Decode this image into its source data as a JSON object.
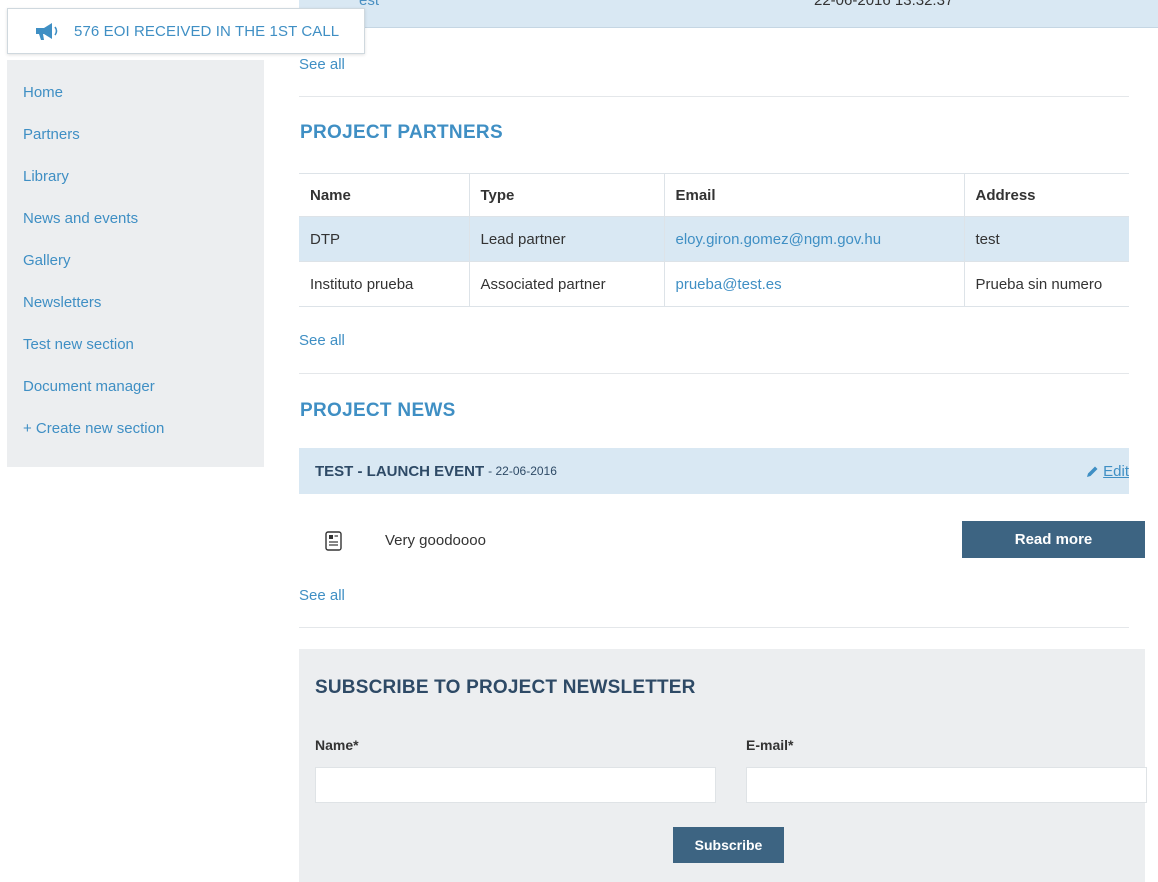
{
  "top_row": {
    "name_fragment": "est",
    "date_fragment": "22-06-2016 13:32:37"
  },
  "announcement": {
    "text": "576 EOI RECEIVED IN THE 1ST CALL",
    "icon": "megaphone-icon"
  },
  "sidebar": {
    "items": [
      {
        "label": "Home"
      },
      {
        "label": "Partners"
      },
      {
        "label": "Library"
      },
      {
        "label": "News and events"
      },
      {
        "label": "Gallery"
      },
      {
        "label": "Newsletters"
      },
      {
        "label": "Test new section"
      },
      {
        "label": "Document manager"
      },
      {
        "label": "+ Create new section"
      }
    ]
  },
  "see_all_label": "See all",
  "partners": {
    "title": "PROJECT PARTNERS",
    "columns": [
      "Name",
      "Type",
      "Email",
      "Address"
    ],
    "rows": [
      {
        "name": "DTP",
        "type": "Lead partner",
        "email": "eloy.giron.gomez@ngm.gov.hu",
        "address": "test"
      },
      {
        "name": "Instituto prueba",
        "type": "Associated partner",
        "email": "prueba@test.es",
        "address": "Prueba sin numero"
      }
    ]
  },
  "news": {
    "title": "PROJECT NEWS",
    "item": {
      "headline": "TEST - LAUNCH EVENT",
      "date": "- 22-06-2016",
      "edit_label": "Edit",
      "body": "Very goodoooo",
      "read_more_label": "Read more"
    }
  },
  "subscribe": {
    "title": "SUBSCRIBE TO PROJECT NEWSLETTER",
    "name_label": "Name*",
    "email_label": "E-mail*",
    "name_value": "",
    "email_value": "",
    "button_label": "Subscribe"
  },
  "colors": {
    "accent": "#3f8fc4",
    "highlight": "#d9e8f3",
    "dark_button": "#3d6482",
    "panel": "#eceef0"
  }
}
